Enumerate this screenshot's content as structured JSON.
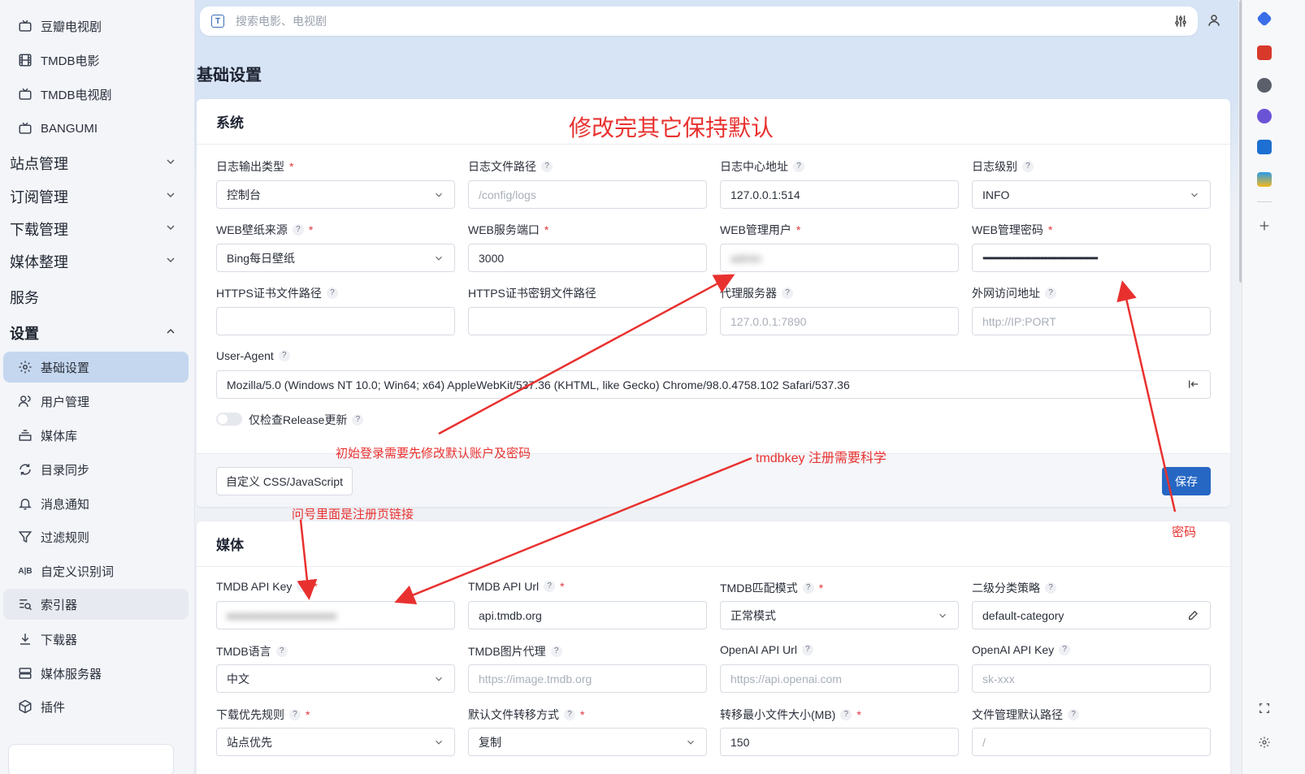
{
  "sidebar": {
    "items_top": [
      {
        "label": "豆瓣电视剧",
        "icon": "tv-icon"
      },
      {
        "label": "TMDB电影",
        "icon": "film-icon"
      },
      {
        "label": "TMDB电视剧",
        "icon": "tv-icon"
      },
      {
        "label": "BANGUMI",
        "icon": "tv-icon"
      }
    ],
    "groups": [
      {
        "label": "站点管理"
      },
      {
        "label": "订阅管理"
      },
      {
        "label": "下载管理"
      },
      {
        "label": "媒体整理"
      },
      {
        "label": "服务"
      },
      {
        "label": "设置"
      }
    ],
    "settings_items": [
      {
        "label": "基础设置",
        "icon": "gear-icon"
      },
      {
        "label": "用户管理",
        "icon": "users-icon"
      },
      {
        "label": "媒体库",
        "icon": "library-icon"
      },
      {
        "label": "目录同步",
        "icon": "sync-icon"
      },
      {
        "label": "消息通知",
        "icon": "bell-icon"
      },
      {
        "label": "过滤规则",
        "icon": "filter-icon"
      },
      {
        "label": "自定义识别词",
        "icon": "text-replace-icon",
        "glyph": "A|B"
      },
      {
        "label": "索引器",
        "icon": "indexer-icon"
      },
      {
        "label": "下载器",
        "icon": "download-icon"
      },
      {
        "label": "媒体服务器",
        "icon": "server-icon"
      },
      {
        "label": "插件",
        "icon": "plugin-icon"
      }
    ]
  },
  "search": {
    "placeholder": "搜索电影、电视剧",
    "logo": "T"
  },
  "page_title": "基础设置",
  "system": {
    "title": "系统",
    "fields": {
      "log_type": {
        "label": "日志输出类型",
        "value": "控制台"
      },
      "log_path": {
        "label": "日志文件路径",
        "placeholder": "/config/logs"
      },
      "log_center": {
        "label": "日志中心地址",
        "value": "127.0.0.1:514"
      },
      "log_level": {
        "label": "日志级别",
        "value": "INFO"
      },
      "wallpaper": {
        "label": "WEB壁纸来源",
        "value": "Bing每日壁纸"
      },
      "web_port": {
        "label": "WEB服务端口",
        "value": "3000"
      },
      "web_user": {
        "label": "WEB管理用户",
        "value": "admin"
      },
      "web_pass": {
        "label": "WEB管理密码",
        "value": "••••••••••••••••••••••••••••••••••••••••••••••••••••••••••••••••"
      },
      "https_cert": {
        "label": "HTTPS证书文件路径"
      },
      "https_key": {
        "label": "HTTPS证书密钥文件路径"
      },
      "proxy": {
        "label": "代理服务器",
        "placeholder": "127.0.0.1:7890"
      },
      "external": {
        "label": "外网访问地址",
        "placeholder": "http://IP:PORT"
      },
      "user_agent": {
        "label": "User-Agent",
        "value": "Mozilla/5.0 (Windows NT 10.0; Win64; x64) AppleWebKit/537.36 (KHTML, like Gecko) Chrome/98.0.4758.102 Safari/537.36"
      }
    },
    "release_toggle": {
      "label": "仅检查Release更新",
      "on": false
    },
    "custom_css_button": "自定义 CSS/JavaScript",
    "save_button": "保存"
  },
  "media": {
    "title": "媒体",
    "fields": {
      "tmdb_key": {
        "label": "TMDB API Key",
        "value": "●●●●●●●●●●●●●●●●"
      },
      "tmdb_url": {
        "label": "TMDB API Url",
        "value": "api.tmdb.org"
      },
      "tmdb_match": {
        "label": "TMDB匹配模式",
        "value": "正常模式"
      },
      "category": {
        "label": "二级分类策略",
        "value": "default-category"
      },
      "tmdb_lang": {
        "label": "TMDB语言",
        "value": "中文"
      },
      "tmdb_img": {
        "label": "TMDB图片代理",
        "placeholder": "https://image.tmdb.org"
      },
      "openai_url": {
        "label": "OpenAI API Url",
        "placeholder": "https://api.openai.com"
      },
      "openai_key": {
        "label": "OpenAI API Key",
        "placeholder": "sk-xxx"
      },
      "dl_rule": {
        "label": "下载优先规则",
        "value": "站点优先"
      },
      "transfer": {
        "label": "默认文件转移方式",
        "value": "复制"
      },
      "min_size": {
        "label": "转移最小文件大小(MB)",
        "value": "150"
      },
      "file_path": {
        "label": "文件管理默认路径",
        "placeholder": "/"
      }
    }
  },
  "annotations": {
    "top": "修改完其它保持默认",
    "login": "初始登录需要先修改默认账户及密码",
    "tmdb": "tmdbkey  注册需要科学",
    "question": "问号里面是注册页链接",
    "password": "密码"
  },
  "colors": {
    "accent": "#2667c4",
    "annotation": "#e8312f",
    "active_nav": "#c5d7ef"
  }
}
